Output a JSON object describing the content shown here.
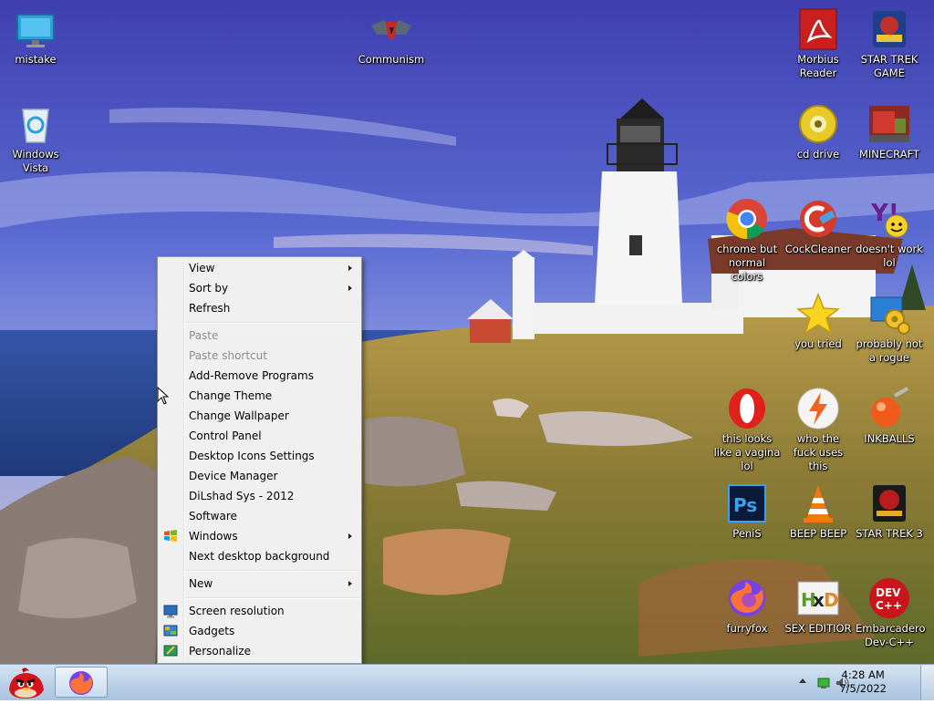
{
  "desktop": {
    "icons": [
      {
        "label": "mistake",
        "icon": "monitor-icon"
      },
      {
        "label": "Windows Vista",
        "icon": "recycle-bin-icon"
      },
      {
        "label": "Communism",
        "icon": "emblem-icon"
      },
      {
        "label": "Morbius Reader",
        "icon": "pdf-reader-icon"
      },
      {
        "label": "STAR TREK GAME",
        "icon": "star-wars-game-icon"
      },
      {
        "label": "cd drive",
        "icon": "cd-drive-icon"
      },
      {
        "label": "MINECRAFT",
        "icon": "minecraft-icon"
      },
      {
        "label": "chrome but normal colors",
        "icon": "chrome-icon"
      },
      {
        "label": "CockCleaner",
        "icon": "ccleaner-icon"
      },
      {
        "label": "doesn't work lol",
        "icon": "yahoo-messenger-icon"
      },
      {
        "label": "you tried",
        "icon": "star-icon"
      },
      {
        "label": "probably not a rogue",
        "icon": "gears-monitor-icon"
      },
      {
        "label": "this looks like a vagina lol",
        "icon": "opera-icon"
      },
      {
        "label": "who the fuck uses this",
        "icon": "lightning-icon"
      },
      {
        "label": "INKBALLS",
        "icon": "inkball-icon"
      },
      {
        "label": "PeniS",
        "icon": "photoshop-icon"
      },
      {
        "label": "BEEP BEEP",
        "icon": "vlc-cone-icon"
      },
      {
        "label": "STAR TREK 3",
        "icon": "star-wars-3-icon"
      },
      {
        "label": "furryfox",
        "icon": "firefox-icon"
      },
      {
        "label": "SEX EDITIOR",
        "icon": "hxd-editor-icon"
      },
      {
        "label": "Embarcadero Dev-C++",
        "icon": "devcpp-icon"
      }
    ]
  },
  "context_menu": {
    "items": [
      {
        "label": "View",
        "submenu": true
      },
      {
        "label": "Sort by",
        "submenu": true
      },
      {
        "label": "Refresh"
      },
      {
        "label": "Paste",
        "disabled": true
      },
      {
        "label": "Paste shortcut",
        "disabled": true
      },
      {
        "label": "Add-Remove Programs"
      },
      {
        "label": "Change Theme"
      },
      {
        "label": "Change Wallpaper"
      },
      {
        "label": "Control Panel"
      },
      {
        "label": "Desktop Icons Settings"
      },
      {
        "label": "Device Manager"
      },
      {
        "label": "DiLshad Sys - 2012"
      },
      {
        "label": "Software"
      },
      {
        "label": "Windows",
        "submenu": true,
        "icon": "windows-flag-icon"
      },
      {
        "label": "Next desktop background"
      },
      {
        "label": "New",
        "submenu": true
      },
      {
        "label": "Screen resolution",
        "icon": "display-icon"
      },
      {
        "label": "Gadgets",
        "icon": "gadgets-icon"
      },
      {
        "label": "Personalize",
        "icon": "personalize-icon"
      }
    ]
  },
  "taskbar": {
    "start_icon": "angry-bird-icon",
    "pinned": [
      {
        "icon": "firefox-icon"
      }
    ],
    "clock": {
      "time": "4:28 AM",
      "date": "7/5/2022"
    }
  },
  "colors": {
    "accent": "#1a5fb4",
    "menu_bg": "#f0f0f0",
    "taskbar": "#bcd1e8"
  }
}
